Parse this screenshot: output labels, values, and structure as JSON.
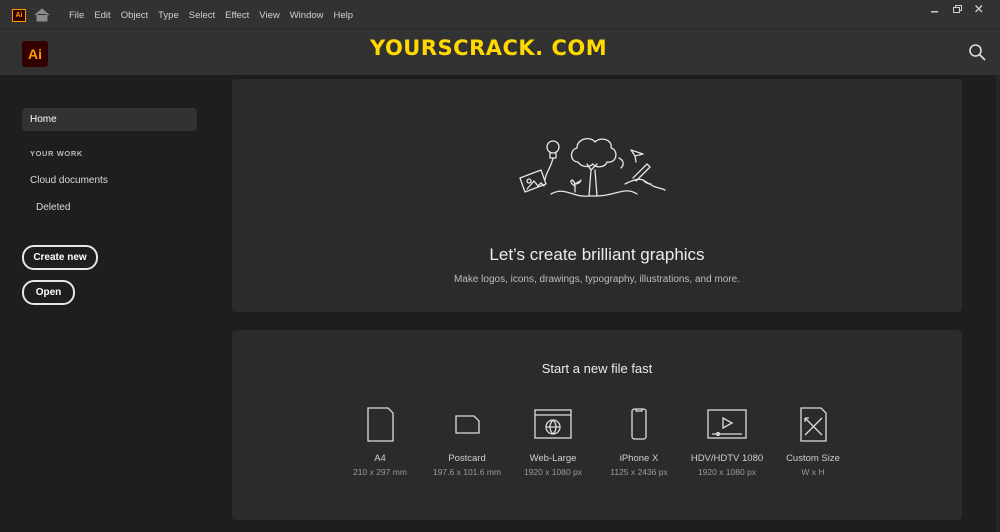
{
  "menubar": {
    "logo": "Ai",
    "items": [
      "File",
      "Edit",
      "Object",
      "Type",
      "Select",
      "Effect",
      "View",
      "Window",
      "Help"
    ]
  },
  "header": {
    "logo": "Ai",
    "watermark": "YOURSCRACK. COM"
  },
  "sidebar": {
    "home": "Home",
    "section": "YOUR WORK",
    "cloud_documents": "Cloud documents",
    "deleted": "Deleted",
    "create_new": "Create new",
    "open": "Open"
  },
  "hero": {
    "title": "Let’s create brilliant graphics",
    "subtitle": "Make logos, icons, drawings, typography, illustrations, and more."
  },
  "new_file": {
    "title": "Start a new file fast",
    "presets": [
      {
        "name": "A4",
        "dims": "210 x 297 mm",
        "icon": "document-icon"
      },
      {
        "name": "Postcard",
        "dims": "197.6 x 101.6 mm",
        "icon": "postcard-icon"
      },
      {
        "name": "Web-Large",
        "dims": "1920 x 1080 px",
        "icon": "web-icon"
      },
      {
        "name": "iPhone X",
        "dims": "1125 x 2436 px",
        "icon": "phone-icon"
      },
      {
        "name": "HDV/HDTV 1080",
        "dims": "1920 x 1080 px",
        "icon": "video-icon"
      },
      {
        "name": "Custom Size",
        "dims": "W x H",
        "icon": "custom-size-icon"
      }
    ]
  },
  "colors": {
    "brand": "#ff9a00",
    "brand_bg": "#330000",
    "watermark": "#ffd900",
    "card_bg": "#2b2b2b",
    "app_bg": "#1e1e1e"
  }
}
